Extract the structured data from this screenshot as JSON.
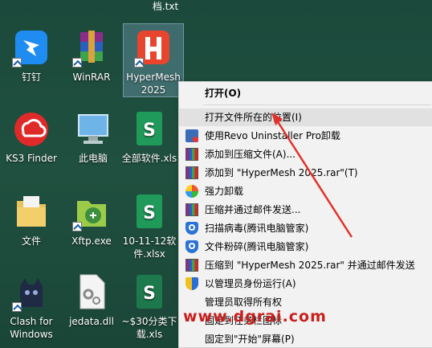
{
  "desktop": {
    "top_label": "档.txt",
    "icons": [
      {
        "label": "钉钉",
        "icon": "dingtalk-icon"
      },
      {
        "label": "WinRAR",
        "icon": "winrar-icon"
      },
      {
        "label": "HyperMesh 2025",
        "icon": "hypermesh-icon"
      },
      {
        "label": "KS3 Finder",
        "icon": "ks3-finder-icon"
      },
      {
        "label": "此电脑",
        "icon": "this-pc-icon"
      },
      {
        "label": "全部软件.xls",
        "icon": "spreadsheet-icon"
      },
      {
        "label": "文件",
        "icon": "folder-icon"
      },
      {
        "label": "Xftp.exe",
        "icon": "xftp-icon"
      },
      {
        "label": "10-11-12软件.xlsx",
        "icon": "spreadsheet-icon"
      },
      {
        "label": "Clash for Windows",
        "icon": "clash-cat-icon"
      },
      {
        "label": "jedata.dll",
        "icon": "dll-file-icon"
      },
      {
        "label": "~$30分类下载.xls",
        "icon": "spreadsheet-icon"
      }
    ]
  },
  "context_menu": {
    "items": [
      {
        "label": "打开(O)",
        "bold": true
      },
      {
        "label": "打开文件所在的位置(I)",
        "highlighted": true
      },
      {
        "label": "使用Revo Uninstaller Pro卸载",
        "icon": "revo-icon"
      },
      {
        "label": "添加到压缩文件(A)...",
        "icon": "winrar-icon"
      },
      {
        "label": "添加到 \"HyperMesh 2025.rar\"(T)",
        "icon": "winrar-icon"
      },
      {
        "label": "强力卸载",
        "icon": "uninstall-flower-icon"
      },
      {
        "label": "压缩并通过邮件发送...",
        "icon": "winrar-icon"
      },
      {
        "label": "扫描病毒(腾讯电脑管家)",
        "icon": "tencent-shield-icon"
      },
      {
        "label": "文件粉碎(腾讯电脑管家)",
        "icon": "tencent-shield-icon"
      },
      {
        "label": "压缩到 \"HyperMesh 2025.rar\" 并通过邮件发送",
        "icon": "winrar-icon"
      },
      {
        "label": "以管理员身份运行(A)",
        "icon": "uac-shield-icon"
      },
      {
        "label": "管理员取得所有权"
      },
      {
        "label": "固定到任务栏图标"
      },
      {
        "label": "固定到\"开始\"屏幕(P)"
      }
    ]
  },
  "watermark": "www.dgrai.com",
  "colors": {
    "menu_bg": "#f2f2f2",
    "highlight": "#e1e1e1",
    "annotation_arrow": "#e0322b"
  }
}
